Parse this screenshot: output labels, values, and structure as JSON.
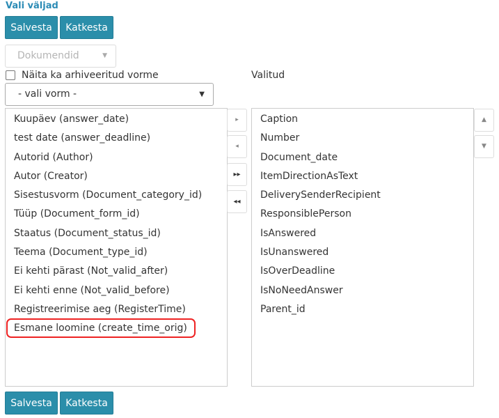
{
  "header": {
    "title": "Vali väljad"
  },
  "toolbar_top": {
    "save_label": "Salvesta",
    "cancel_label": "Katkesta"
  },
  "toolbar_bottom": {
    "save_label": "Salvesta",
    "cancel_label": "Katkesta"
  },
  "documents_dropdown": {
    "value": "Dokumendid"
  },
  "archive_checkbox": {
    "label": "Näita ka arhiveeritud vorme",
    "checked": false
  },
  "form_select": {
    "value": "- vali vorm -"
  },
  "selected_header": "Valitud",
  "available_fields": [
    "Kuupäev (answer_date)",
    "test date (answer_deadline)",
    "Autorid (Author)",
    "Autor (Creator)",
    "Sisestusvorm (Document_category_id)",
    "Tüüp (Document_form_id)",
    "Staatus (Document_status_id)",
    "Teema (Document_type_id)",
    "Ei kehti pärast (Not_valid_after)",
    "Ei kehti enne (Not_valid_before)",
    "Registreerimise aeg (RegisterTime)",
    "Esmane loomine (create_time_orig)"
  ],
  "selected_fields": [
    "Caption",
    "Number",
    "Document_date",
    "ItemDirectionAsText",
    "DeliverySenderRecipient",
    "ResponsiblePerson",
    "IsAnswered",
    "IsUnanswered",
    "IsOverDeadline",
    "IsNoNeedAnswer",
    "Parent_id"
  ],
  "icons": {
    "move_right": "▸",
    "move_left": "◂",
    "move_all_right": "▸▸",
    "move_all_left": "◂◂",
    "move_up": "▲",
    "move_down": "▼",
    "dropdown_caret": "▼"
  },
  "colors": {
    "accent": "#2b8eaa",
    "title": "#2b8bb5",
    "highlight": "#e22222"
  }
}
